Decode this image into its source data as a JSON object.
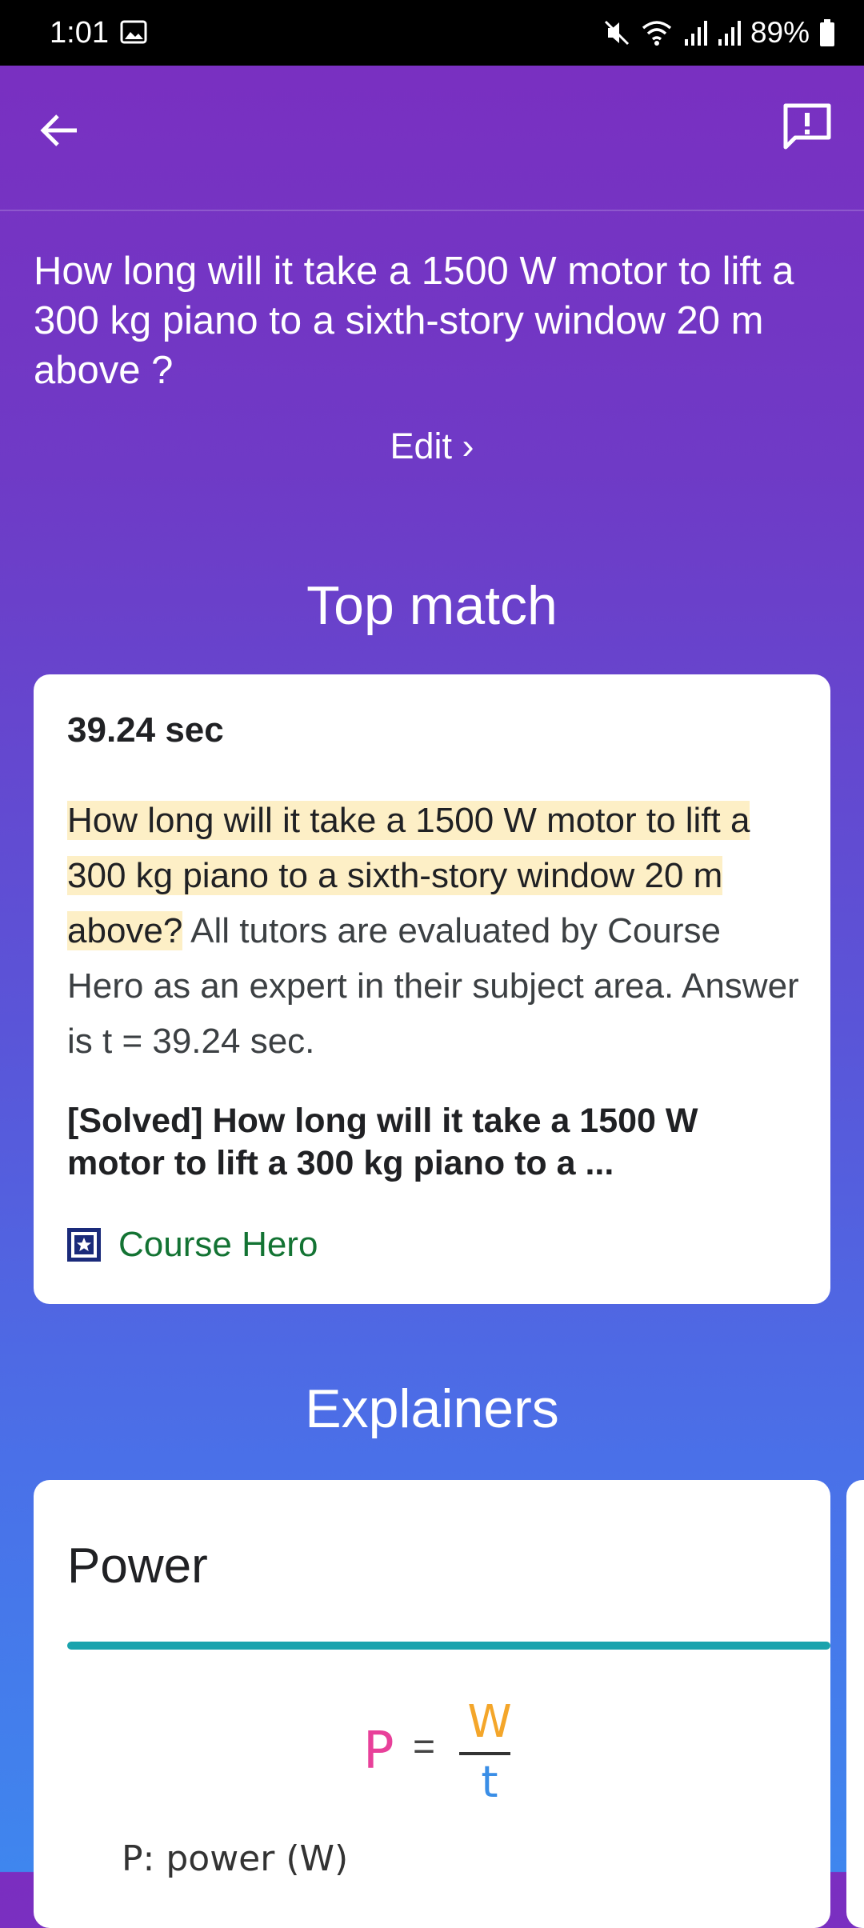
{
  "status_bar": {
    "time": "1:01",
    "battery": "89%",
    "icons": [
      "image-icon",
      "mute-icon",
      "wifi-icon",
      "signal-icon",
      "signal-icon",
      "battery-icon"
    ]
  },
  "app_bar": {
    "back_icon": "arrow-left-icon",
    "feedback_icon": "feedback-icon"
  },
  "query": {
    "text": "How long will it take a 1500 W motor to lift a 300 kg piano to a sixth-story window 20 m above ?",
    "edit_label": "Edit ›"
  },
  "top_match": {
    "heading": "Top match",
    "answer": "39.24 sec",
    "snippet_highlight": "How long will it take a 1500 W motor to lift a 300 kg piano to a sixth-story window 20 m above?",
    "snippet_rest": " All tutors are evaluated by Course Hero as an expert in their subject area. Answer is t = 39.24 sec.",
    "result_title": "[Solved] How long will it take a 1500 W motor to lift a 300 kg piano to a ...",
    "source_name": "Course Hero",
    "source_color": "#137333"
  },
  "explainers": {
    "heading": "Explainers",
    "card_title": "Power",
    "accent_color": "#1aa3ad",
    "formula": {
      "lhs": "P",
      "equals": "=",
      "numerator": "W",
      "denominator": "t"
    },
    "legend_line": "P: power (W)"
  }
}
